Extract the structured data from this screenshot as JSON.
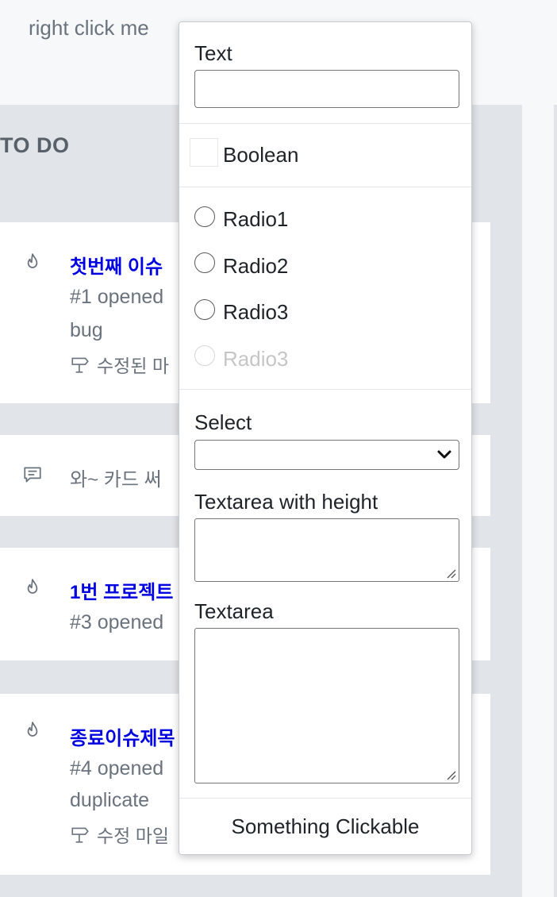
{
  "trigger": {
    "label": "right click me"
  },
  "column": {
    "title": "TO DO"
  },
  "cards": [
    {
      "title": "첫번째 이슈",
      "meta": "#1 opened",
      "label": "bug",
      "milestone": "수정된 마"
    },
    {
      "note": "와~ 카드 써"
    },
    {
      "title": "1번 프로젝트",
      "meta": "#3 opened"
    },
    {
      "title": "종료이슈제목",
      "meta": "#4 opened",
      "label": "duplicate",
      "milestone": "수정 마일"
    }
  ],
  "menu": {
    "text_label": "Text",
    "text_value": "",
    "boolean_label": "Boolean",
    "boolean_checked": false,
    "radios": [
      {
        "label": "Radio1",
        "disabled": false
      },
      {
        "label": "Radio2",
        "disabled": false
      },
      {
        "label": "Radio3",
        "disabled": false
      },
      {
        "label": "Radio3",
        "disabled": true
      }
    ],
    "select_label": "Select",
    "select_value": "",
    "textarea_height_label": "Textarea with height",
    "textarea_label": "Textarea",
    "clickable_label": "Something Clickable"
  },
  "colors": {
    "issue_title": "#0000e0",
    "muted_text": "#6a737d",
    "column_bg": "#e1e4e8"
  },
  "icons": {
    "issue": "flame-icon",
    "note": "comment-icon",
    "milestone": "milestone-icon"
  }
}
